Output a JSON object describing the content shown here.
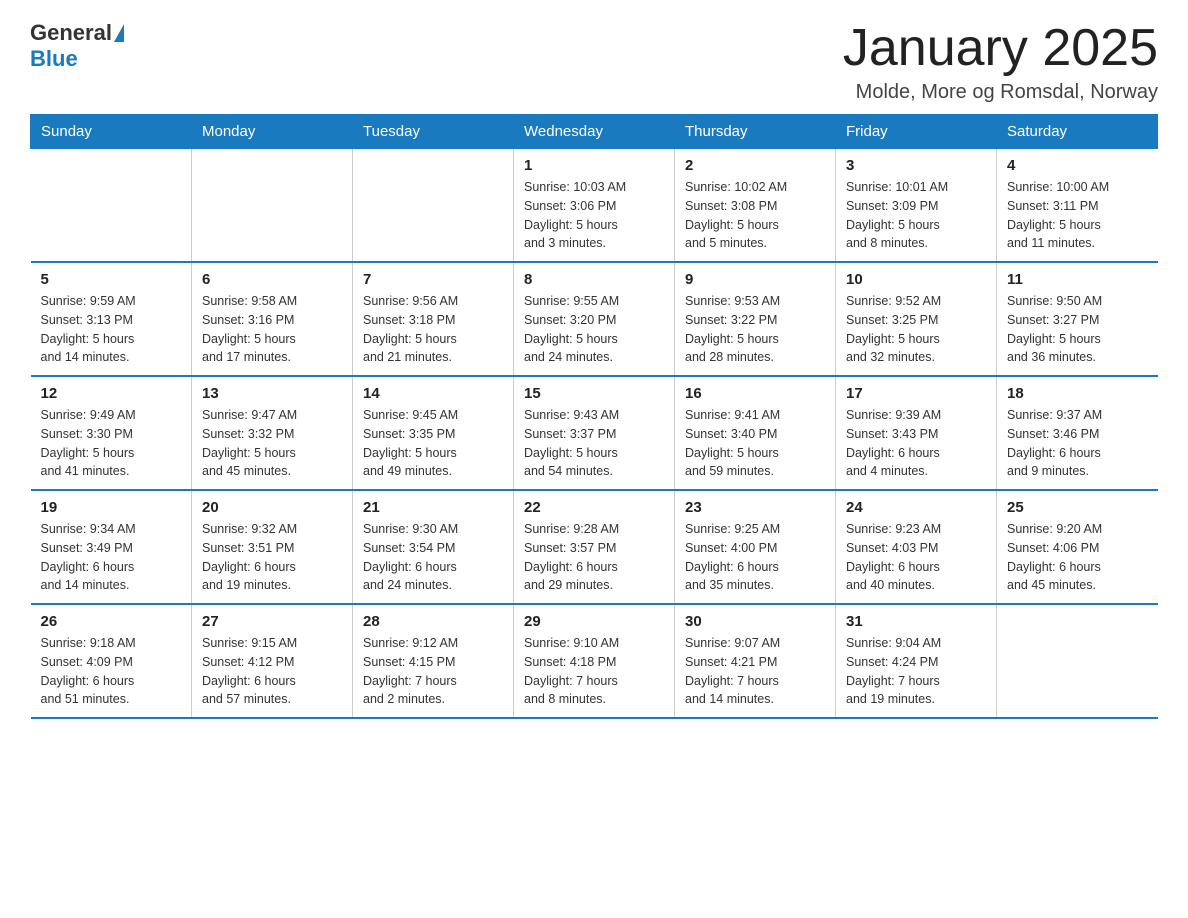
{
  "logo": {
    "general": "General",
    "blue": "Blue"
  },
  "header": {
    "title": "January 2025",
    "location": "Molde, More og Romsdal, Norway"
  },
  "weekdays": [
    "Sunday",
    "Monday",
    "Tuesday",
    "Wednesday",
    "Thursday",
    "Friday",
    "Saturday"
  ],
  "weeks": [
    [
      {
        "day": "",
        "info": ""
      },
      {
        "day": "",
        "info": ""
      },
      {
        "day": "",
        "info": ""
      },
      {
        "day": "1",
        "info": "Sunrise: 10:03 AM\nSunset: 3:06 PM\nDaylight: 5 hours\nand 3 minutes."
      },
      {
        "day": "2",
        "info": "Sunrise: 10:02 AM\nSunset: 3:08 PM\nDaylight: 5 hours\nand 5 minutes."
      },
      {
        "day": "3",
        "info": "Sunrise: 10:01 AM\nSunset: 3:09 PM\nDaylight: 5 hours\nand 8 minutes."
      },
      {
        "day": "4",
        "info": "Sunrise: 10:00 AM\nSunset: 3:11 PM\nDaylight: 5 hours\nand 11 minutes."
      }
    ],
    [
      {
        "day": "5",
        "info": "Sunrise: 9:59 AM\nSunset: 3:13 PM\nDaylight: 5 hours\nand 14 minutes."
      },
      {
        "day": "6",
        "info": "Sunrise: 9:58 AM\nSunset: 3:16 PM\nDaylight: 5 hours\nand 17 minutes."
      },
      {
        "day": "7",
        "info": "Sunrise: 9:56 AM\nSunset: 3:18 PM\nDaylight: 5 hours\nand 21 minutes."
      },
      {
        "day": "8",
        "info": "Sunrise: 9:55 AM\nSunset: 3:20 PM\nDaylight: 5 hours\nand 24 minutes."
      },
      {
        "day": "9",
        "info": "Sunrise: 9:53 AM\nSunset: 3:22 PM\nDaylight: 5 hours\nand 28 minutes."
      },
      {
        "day": "10",
        "info": "Sunrise: 9:52 AM\nSunset: 3:25 PM\nDaylight: 5 hours\nand 32 minutes."
      },
      {
        "day": "11",
        "info": "Sunrise: 9:50 AM\nSunset: 3:27 PM\nDaylight: 5 hours\nand 36 minutes."
      }
    ],
    [
      {
        "day": "12",
        "info": "Sunrise: 9:49 AM\nSunset: 3:30 PM\nDaylight: 5 hours\nand 41 minutes."
      },
      {
        "day": "13",
        "info": "Sunrise: 9:47 AM\nSunset: 3:32 PM\nDaylight: 5 hours\nand 45 minutes."
      },
      {
        "day": "14",
        "info": "Sunrise: 9:45 AM\nSunset: 3:35 PM\nDaylight: 5 hours\nand 49 minutes."
      },
      {
        "day": "15",
        "info": "Sunrise: 9:43 AM\nSunset: 3:37 PM\nDaylight: 5 hours\nand 54 minutes."
      },
      {
        "day": "16",
        "info": "Sunrise: 9:41 AM\nSunset: 3:40 PM\nDaylight: 5 hours\nand 59 minutes."
      },
      {
        "day": "17",
        "info": "Sunrise: 9:39 AM\nSunset: 3:43 PM\nDaylight: 6 hours\nand 4 minutes."
      },
      {
        "day": "18",
        "info": "Sunrise: 9:37 AM\nSunset: 3:46 PM\nDaylight: 6 hours\nand 9 minutes."
      }
    ],
    [
      {
        "day": "19",
        "info": "Sunrise: 9:34 AM\nSunset: 3:49 PM\nDaylight: 6 hours\nand 14 minutes."
      },
      {
        "day": "20",
        "info": "Sunrise: 9:32 AM\nSunset: 3:51 PM\nDaylight: 6 hours\nand 19 minutes."
      },
      {
        "day": "21",
        "info": "Sunrise: 9:30 AM\nSunset: 3:54 PM\nDaylight: 6 hours\nand 24 minutes."
      },
      {
        "day": "22",
        "info": "Sunrise: 9:28 AM\nSunset: 3:57 PM\nDaylight: 6 hours\nand 29 minutes."
      },
      {
        "day": "23",
        "info": "Sunrise: 9:25 AM\nSunset: 4:00 PM\nDaylight: 6 hours\nand 35 minutes."
      },
      {
        "day": "24",
        "info": "Sunrise: 9:23 AM\nSunset: 4:03 PM\nDaylight: 6 hours\nand 40 minutes."
      },
      {
        "day": "25",
        "info": "Sunrise: 9:20 AM\nSunset: 4:06 PM\nDaylight: 6 hours\nand 45 minutes."
      }
    ],
    [
      {
        "day": "26",
        "info": "Sunrise: 9:18 AM\nSunset: 4:09 PM\nDaylight: 6 hours\nand 51 minutes."
      },
      {
        "day": "27",
        "info": "Sunrise: 9:15 AM\nSunset: 4:12 PM\nDaylight: 6 hours\nand 57 minutes."
      },
      {
        "day": "28",
        "info": "Sunrise: 9:12 AM\nSunset: 4:15 PM\nDaylight: 7 hours\nand 2 minutes."
      },
      {
        "day": "29",
        "info": "Sunrise: 9:10 AM\nSunset: 4:18 PM\nDaylight: 7 hours\nand 8 minutes."
      },
      {
        "day": "30",
        "info": "Sunrise: 9:07 AM\nSunset: 4:21 PM\nDaylight: 7 hours\nand 14 minutes."
      },
      {
        "day": "31",
        "info": "Sunrise: 9:04 AM\nSunset: 4:24 PM\nDaylight: 7 hours\nand 19 minutes."
      },
      {
        "day": "",
        "info": ""
      }
    ]
  ]
}
